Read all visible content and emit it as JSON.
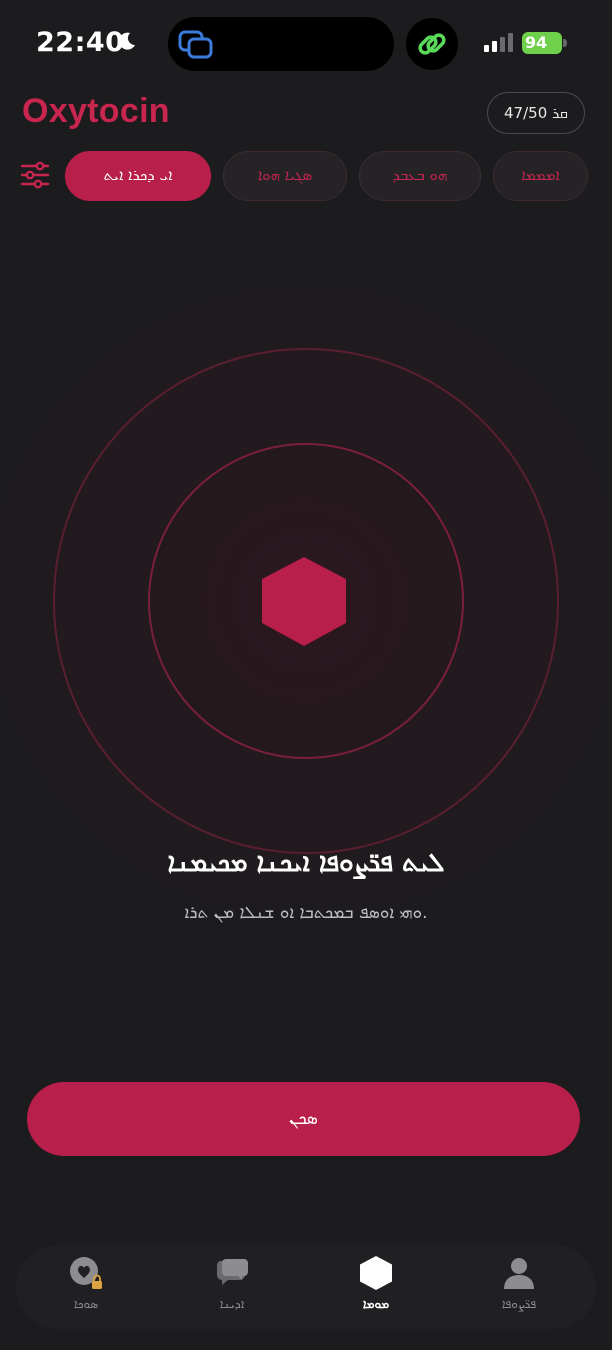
{
  "status_bar": {
    "time": "22:40",
    "battery": "94"
  },
  "header": {
    "app_name": "Oxytocin",
    "credits": "47/50 ܩܪ"
  },
  "filters": {
    "icon": "sliders-icon",
    "chips": [
      {
        "label": "ܐܝ ܕܟܪܐ ܐܝܬ",
        "active": true
      },
      {
        "label": "ܣܓܝܐ ܗܘܐ",
        "active": false
      },
      {
        "label": "ܗܘ ܒܥܒܕ",
        "active": false
      },
      {
        "label": "ܐܡܡܡܐ",
        "active": false
      }
    ]
  },
  "radar": {
    "center_icon": "hexagon-icon"
  },
  "empty_state": {
    "title": "ܠܝܬ ܦܪ̈ܨܘܦܐ ܐܝܟܢܐ ܡܟܝܡܢܐ",
    "subtitle": "ܘܗܝ ܐܘܣܦ ܒܡܟܬܒܐ ܐܘ ܫܢܠܐ ܡܢ ܬܪܐ."
  },
  "actions": {
    "find_label": "ܣܟܢ"
  },
  "nav": {
    "items": [
      {
        "label": "ܣܘܟܐ",
        "icon": "heart-lock-icon",
        "active": false
      },
      {
        "label": "ܐܕܝܢܐ",
        "icon": "chat-bubble-icon",
        "active": false
      },
      {
        "label": "ܡܘܡܐ",
        "icon": "hexagon-icon",
        "active": true
      },
      {
        "label": "ܦܪ̈ܨܘܦܐ",
        "icon": "profile-icon",
        "active": false
      }
    ]
  },
  "colors": {
    "accent": "#b81f4b",
    "brand_text": "#c8254f",
    "background": "#1c1b1e"
  }
}
